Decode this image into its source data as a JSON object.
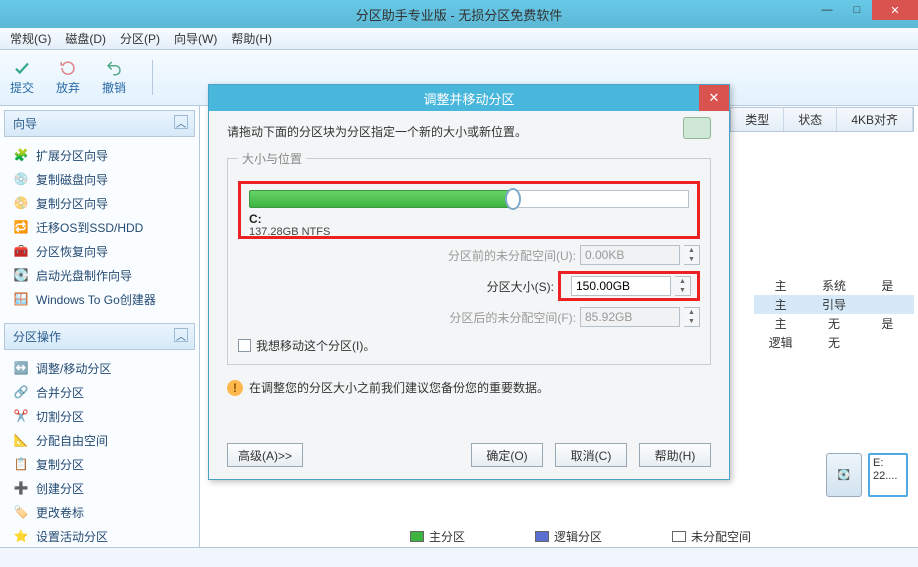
{
  "window": {
    "title": "分区助手专业版 - 无损分区免费软件"
  },
  "menu": {
    "general": "常规(G)",
    "disk": "磁盘(D)",
    "partition": "分区(P)",
    "wizard": "向导(W)",
    "help": "帮助(H)"
  },
  "toolbar": {
    "submit": "提交",
    "discard": "放弃",
    "undo": "撤销"
  },
  "sidebar": {
    "wizard_title": "向导",
    "wizard_items": [
      "扩展分区向导",
      "复制磁盘向导",
      "复制分区向导",
      "迁移OS到SSD/HDD",
      "分区恢复向导",
      "启动光盘制作向导",
      "Windows To Go创建器"
    ],
    "ops_title": "分区操作",
    "ops_items": [
      "调整/移动分区",
      "合并分区",
      "切割分区",
      "分配自由空间",
      "复制分区",
      "创建分区",
      "更改卷标",
      "设置活动分区"
    ]
  },
  "grid": {
    "headers": [
      "类型",
      "状态",
      "4KB对齐"
    ],
    "rows": [
      [
        "主",
        "系统",
        "是"
      ],
      [
        "主",
        "引导",
        ""
      ],
      [
        "主",
        "无",
        "是"
      ],
      [
        "逻辑",
        "无",
        ""
      ]
    ]
  },
  "diskmap": {
    "part_label": "E:",
    "part_sub": "22...."
  },
  "legend": {
    "primary": "主分区",
    "logical": "逻辑分区",
    "unalloc": "未分配空间"
  },
  "dialog": {
    "title": "调整并移动分区",
    "hint": "请拖动下面的分区块为分区指定一个新的大小或新位置。",
    "group_label": "大小与位置",
    "drive_label": "C:",
    "drive_sub": "137.28GB NTFS",
    "row_before_label": "分区前的未分配空间(U):",
    "row_before_value": "0.00KB",
    "row_size_label": "分区大小(S):",
    "row_size_value": "150.00GB",
    "row_after_label": "分区后的未分配空间(F):",
    "row_after_value": "85.92GB",
    "chk_move": "我想移动这个分区(I)。",
    "warn": "在调整您的分区大小之前我们建议您备份您的重要数据。",
    "btn_adv": "高级(A)>>",
    "btn_ok": "确定(O)",
    "btn_cancel": "取消(C)",
    "btn_help": "帮助(H)"
  }
}
